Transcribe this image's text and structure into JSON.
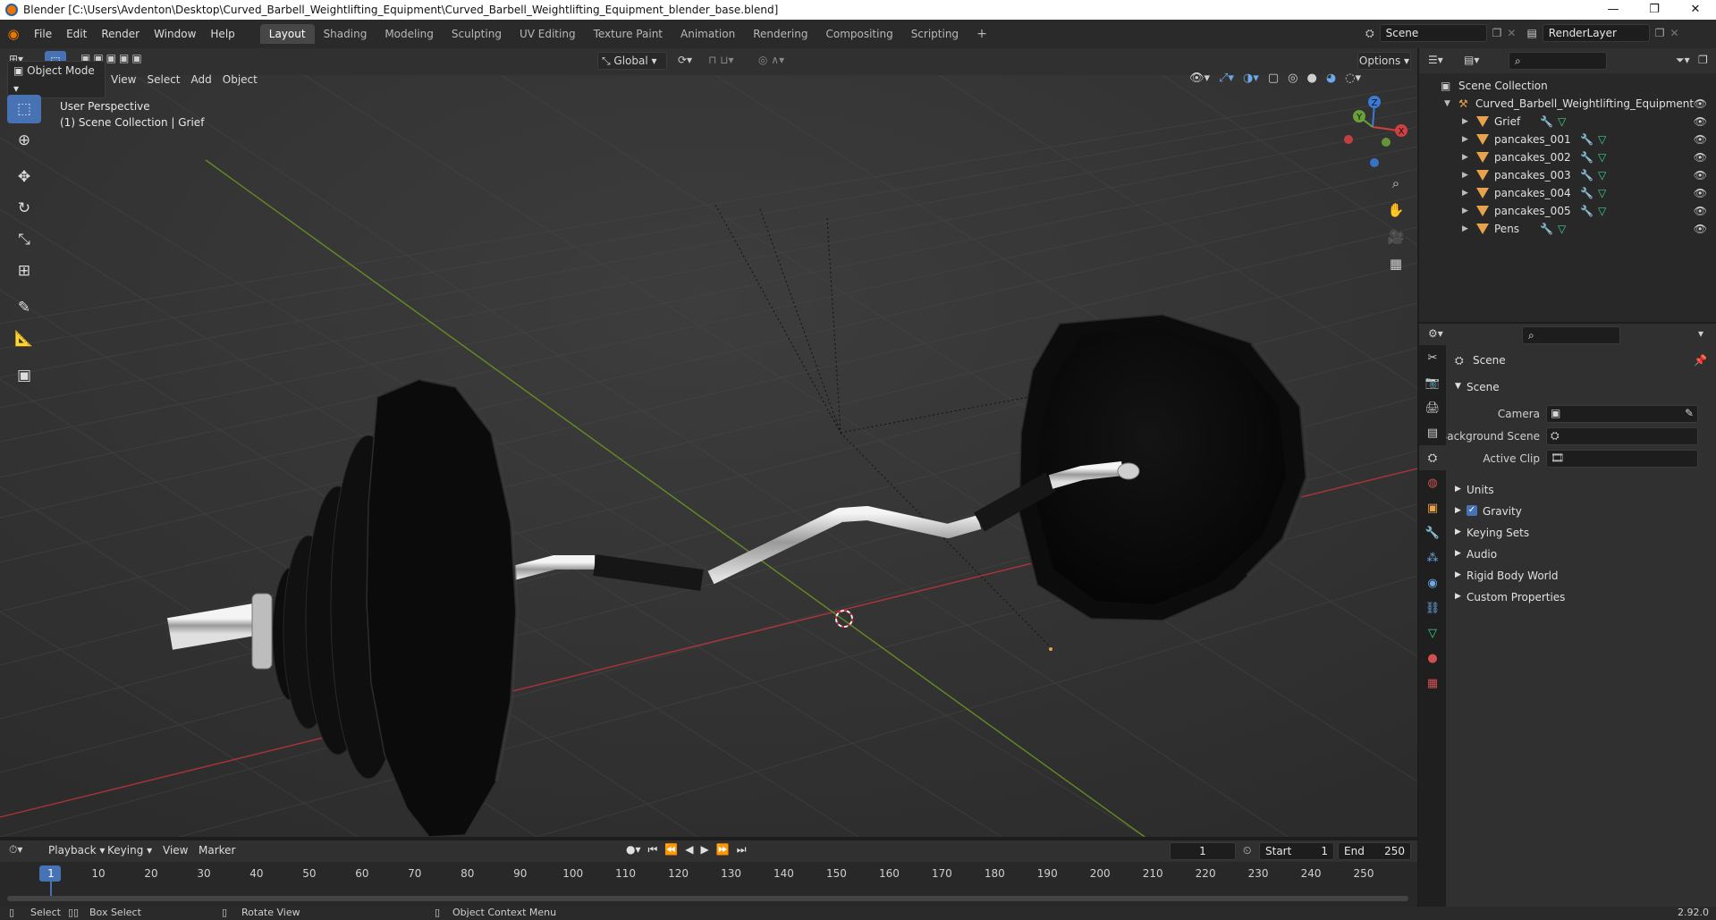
{
  "window": {
    "title": "Blender [C:\\Users\\Avdenton\\Desktop\\Curved_Barbell_Weightlifting_Equipment\\Curved_Barbell_Weightlifting_Equipment_blender_base.blend]",
    "controls": [
      "—",
      "❐",
      "✕"
    ]
  },
  "menu": {
    "items": [
      "File",
      "Edit",
      "Render",
      "Window",
      "Help"
    ],
    "workspaces": [
      "Layout",
      "Shading",
      "Modeling",
      "Sculpting",
      "UV Editing",
      "Texture Paint",
      "Animation",
      "Rendering",
      "Compositing",
      "Scripting"
    ],
    "active_workspace": "Layout",
    "scene_field": "Scene",
    "renderlayer_field": "RenderLayer"
  },
  "viewport": {
    "mode": "Object Mode",
    "menus": [
      "View",
      "Select",
      "Add",
      "Object"
    ],
    "transform_orientation": "Global",
    "options_label": "Options",
    "overlay_line1": "User Perspective",
    "overlay_line2": "(1) Scene Collection | Grief",
    "gizmo_axes": {
      "x": "X",
      "y": "Y",
      "z": "Z"
    }
  },
  "outliner": {
    "root": "Scene Collection",
    "collection": "Curved_Barbell_Weightlifting_Equipment",
    "objects": [
      "Grief",
      "pancakes_001",
      "pancakes_002",
      "pancakes_003",
      "pancakes_004",
      "pancakes_005",
      "Pens"
    ]
  },
  "properties": {
    "context_title": "Scene",
    "panel_title": "Scene",
    "labels": {
      "camera": "Camera",
      "background_scene": "Background Scene",
      "active_clip": "Active Clip"
    },
    "panels": [
      "Units",
      "Gravity",
      "Keying Sets",
      "Audio",
      "Rigid Body World",
      "Custom Properties"
    ],
    "gravity_checked": true
  },
  "timeline": {
    "menus": [
      "Playback",
      "Keying",
      "View",
      "Marker"
    ],
    "current_frame": "1",
    "start_label": "Start",
    "start_value": "1",
    "end_label": "End",
    "end_value": "250",
    "ticks": [
      "1",
      "10",
      "20",
      "30",
      "40",
      "50",
      "60",
      "70",
      "80",
      "90",
      "100",
      "110",
      "120",
      "130",
      "140",
      "150",
      "160",
      "170",
      "180",
      "190",
      "200",
      "210",
      "220",
      "230",
      "240",
      "250"
    ]
  },
  "statusbar": {
    "select": "Select",
    "box_select": "Box Select",
    "rotate_view": "Rotate View",
    "context_menu": "Object Context Menu",
    "version": "2.92.0"
  },
  "colors": {
    "accent": "#4772b3",
    "object_orange": "#e8a24b",
    "modifier_blue": "#6fa8e8",
    "mesh_green": "#3ed08c",
    "axis_x_red": "#c9333f",
    "axis_y_green": "#6c9a21"
  }
}
